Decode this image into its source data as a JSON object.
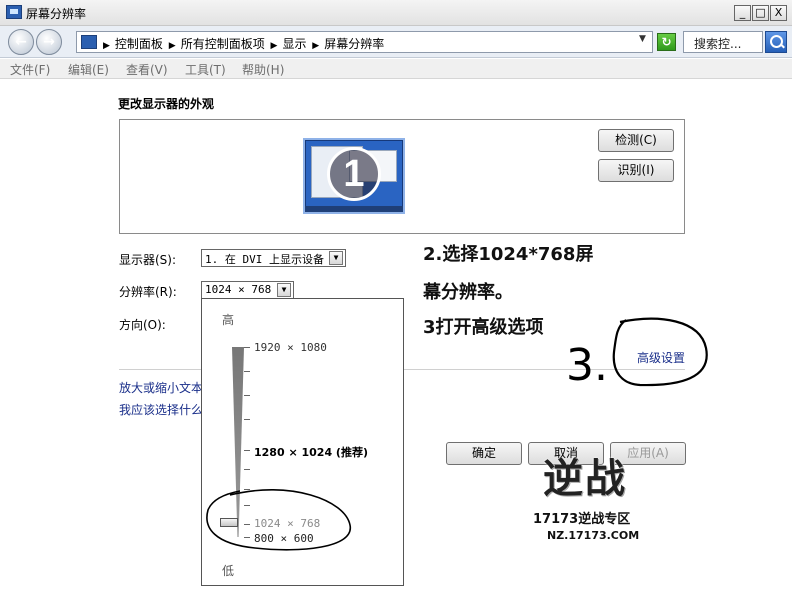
{
  "window": {
    "title": "屏幕分辨率",
    "minimize": "_",
    "maximize": "□",
    "close": "X"
  },
  "address_bar": {
    "breadcrumb": [
      "控制面板",
      "所有控制面板项",
      "显示",
      "屏幕分辨率"
    ],
    "search_placeholder": "搜索控..."
  },
  "menu": [
    "文件(F)",
    "编辑(E)",
    "查看(V)",
    "工具(T)",
    "帮助(H)"
  ],
  "page": {
    "heading": "更改显示器的外观",
    "monitor_number": "1",
    "detect_button": "检测(C)",
    "identify_button": "识别(I)",
    "display_label": "显示器(S):",
    "display_value": "1. 在 DVI 上显示设备",
    "resolution_label": "分辨率(R):",
    "resolution_value": "1024 × 768",
    "orientation_label": "方向(O):",
    "resolution_dropdown": {
      "high_label": "高",
      "low_label": "低",
      "options": [
        "1920 × 1080",
        "1280 × 1024 (推荐)",
        "1024 × 768",
        "800 × 600"
      ],
      "selected": "1024 × 768"
    },
    "advanced_link": "高级设置",
    "link_text_size": "放大或缩小文本和其他项目",
    "link_which_settings": "我应该选择什么显示器设置?",
    "ok_button": "确定",
    "cancel_button": "取消",
    "apply_button": "应用(A)"
  },
  "annotation": {
    "line1": "2.选择1024*768屏",
    "line2": "幕分辨率。",
    "line3": "3打开高级选项",
    "handwritten": "3."
  },
  "watermark": {
    "caption": "17173逆战专区",
    "url": "NZ.17173.COM"
  },
  "colors": {
    "link": "#1a2f8a",
    "monitor_blue": "#2a64c2",
    "annotation_ink": "#000000"
  }
}
